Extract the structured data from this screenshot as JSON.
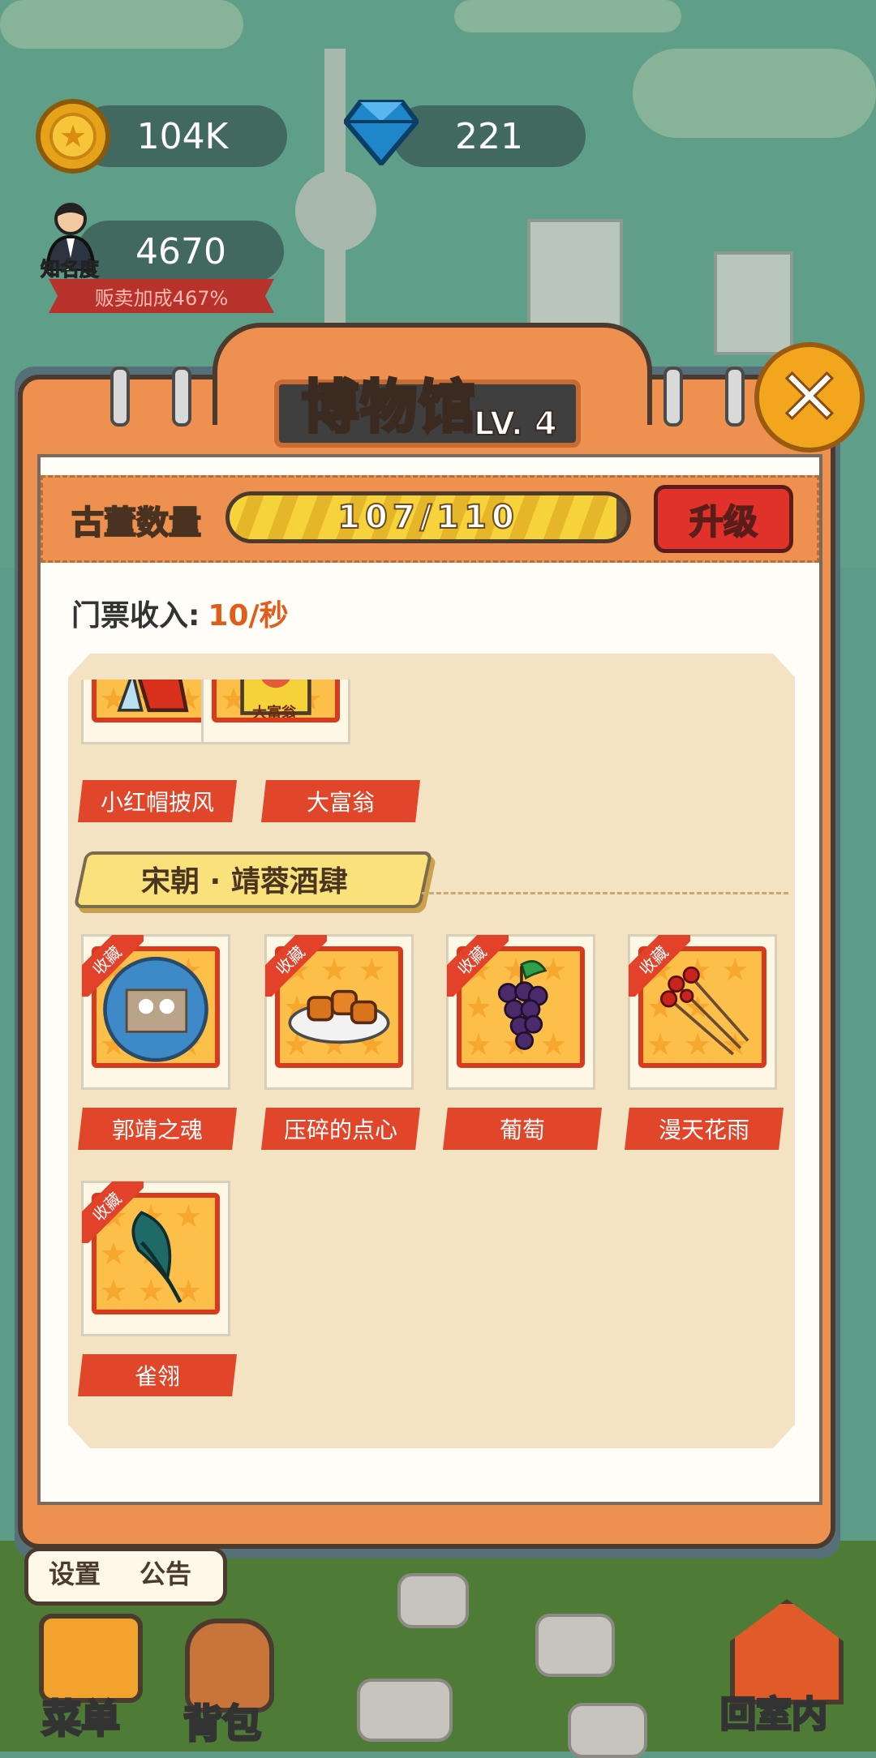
{
  "hud": {
    "coins": "104K",
    "gems": "221",
    "fame_value": "4670",
    "fame_label": "知名度",
    "sales_bonus": "贩卖加成467%"
  },
  "museum": {
    "title": "博物馆",
    "level": "LV. 4",
    "antique_label": "古董数量",
    "antique_count": "107/110",
    "antique_progress": 0.973,
    "upgrade_label": "升级",
    "ticket_label": "门票收入:",
    "ticket_value": "10/秒",
    "close_icon": "close-icon"
  },
  "collection_tag": "收藏",
  "prev_items": [
    {
      "name": "小红帽披风"
    },
    {
      "name": "大富翁",
      "art_text": "大富翁"
    }
  ],
  "section": {
    "title": "宋朝 · 靖蓉酒肆",
    "items": [
      {
        "name": "郭靖之魂"
      },
      {
        "name": "压碎的点心"
      },
      {
        "name": "葡萄"
      },
      {
        "name": "漫天花雨"
      },
      {
        "name": "雀翎"
      }
    ]
  },
  "bottom": {
    "settings": "设置",
    "notice": "公告",
    "menu": "菜单",
    "bag": "背包",
    "go_indoor": "回室内"
  },
  "colors": {
    "panel_orange": "#ee9150",
    "ribbon_red": "#e2462a",
    "upgrade_red": "#e0312b",
    "progress_yellow": "#f7d33b"
  }
}
